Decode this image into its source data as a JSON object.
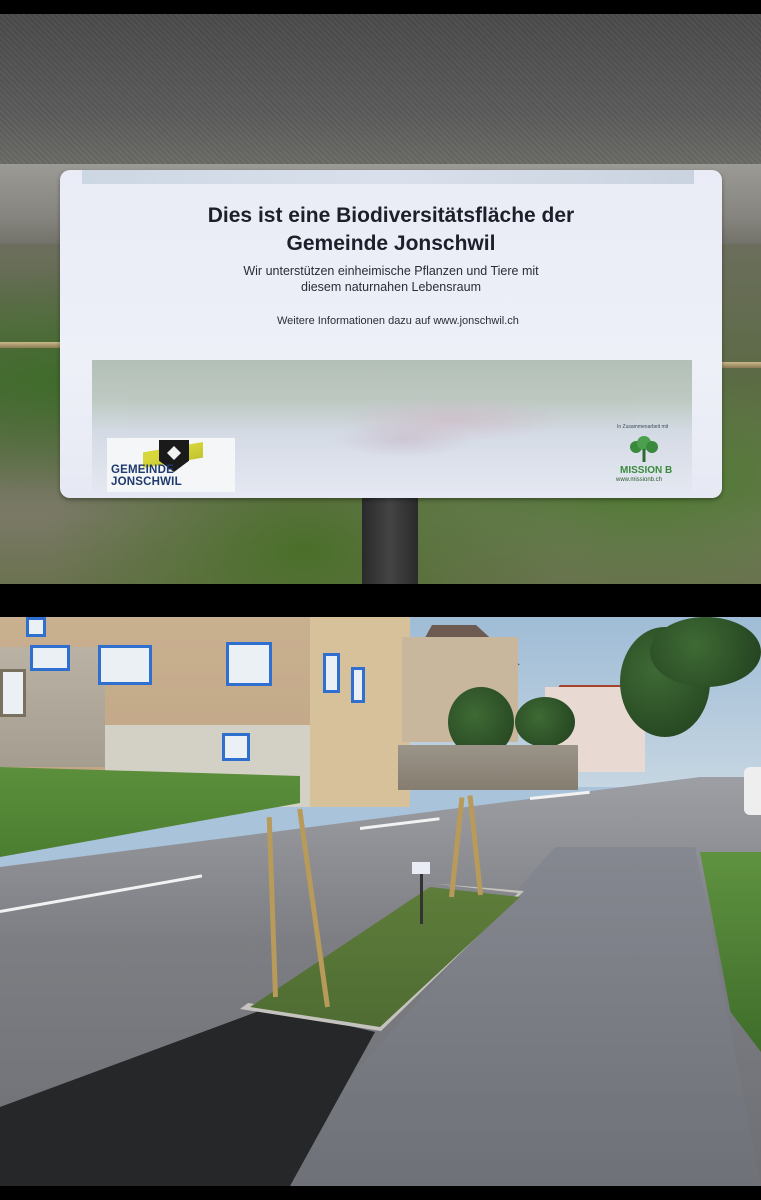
{
  "sign": {
    "title_line1": "Dies ist eine Biodiversitätsfläche der",
    "title_line2": "Gemeinde Jonschwil",
    "subtitle_line1": "Wir unterstützen einheimische Pflanzen und Tiere mit",
    "subtitle_line2": "diesem naturnahen Lebensraum",
    "info": "Weitere Informationen dazu auf www.jonschwil.ch",
    "logo_left_text": "GEMEINDE JONSCHWIL",
    "logo_right_tagline": "In Zusammenarbeit mit",
    "logo_right_text": "MISSION B",
    "logo_right_url": "www.missionb.ch"
  },
  "colors": {
    "sign_background": "#eef0f8",
    "sign_text": "#1d1f2a",
    "logo_blue": "#1e3a6e",
    "mission_green": "#3a8a3e",
    "window_frame_blue": "#2f6fcf"
  }
}
